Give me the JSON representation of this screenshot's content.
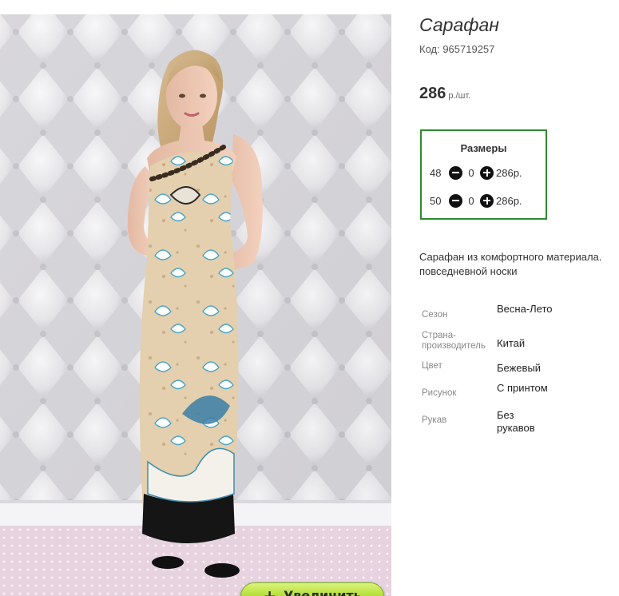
{
  "product": {
    "title": "Сарафан",
    "code": "Код: 965719257",
    "price": "286",
    "price_unit": "р./шт."
  },
  "zoom_button": {
    "icon": "plus-icon",
    "label": "Увеличить"
  },
  "sizes": {
    "title": "Размеры",
    "rows": [
      {
        "size": "48",
        "qty": "0",
        "price": "286р."
      },
      {
        "size": "50",
        "qty": "0",
        "price": "286р."
      }
    ]
  },
  "description": {
    "line1": "Сарафан из комфортного материала.",
    "line2": "повседневной носки"
  },
  "specs": [
    {
      "key": "Сезон",
      "value": "Весна-Лето"
    },
    {
      "key": "Страна-производитель",
      "value": "Китай"
    },
    {
      "key": "Цвет",
      "value": "Бежевый"
    },
    {
      "key": "Рисунок",
      "value": "С принтом"
    },
    {
      "key": "Рукав",
      "value": "Без рукавов"
    }
  ],
  "colors": {
    "accent_border": "#2e8b2e",
    "zoom_button": "#b6e03a"
  }
}
